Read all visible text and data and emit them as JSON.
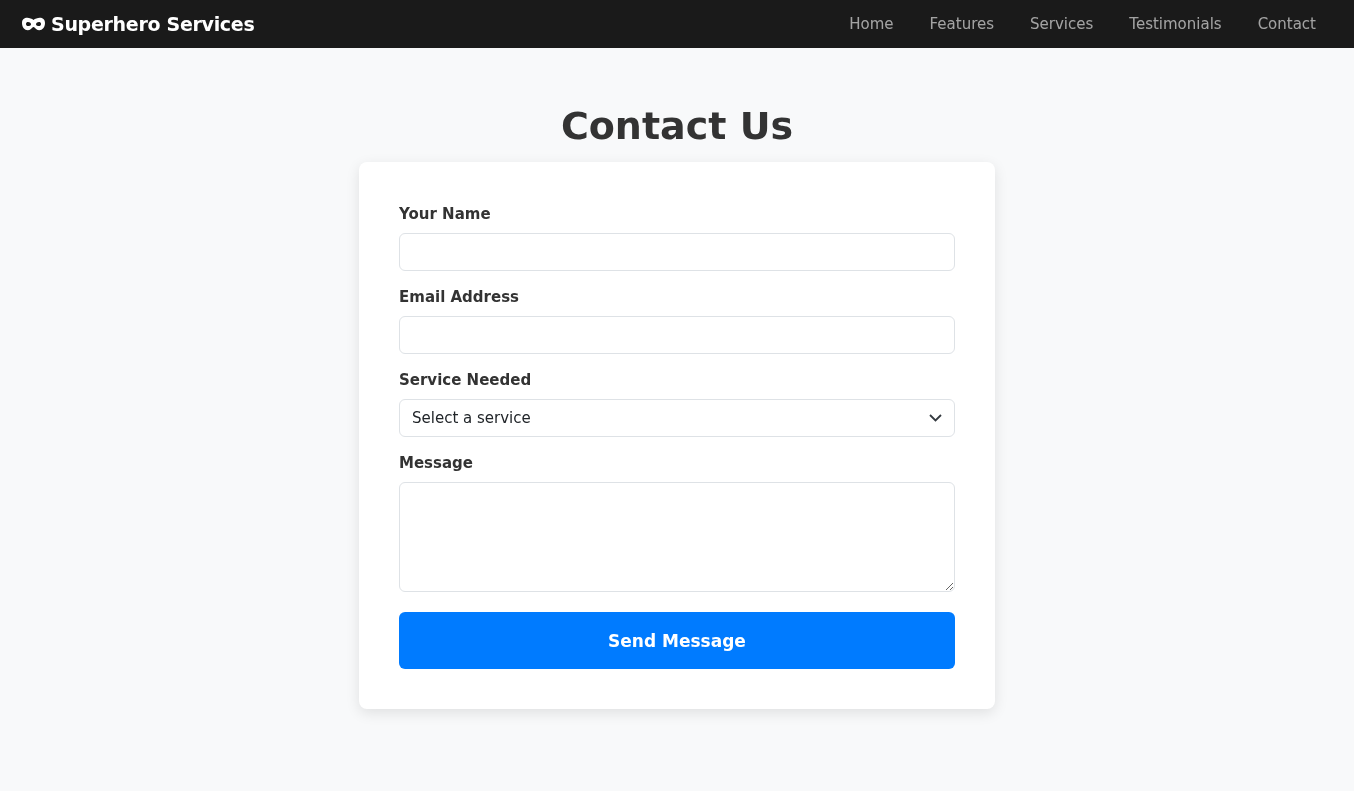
{
  "navbar": {
    "brand": "Superhero Services",
    "links": [
      "Home",
      "Features",
      "Services",
      "Testimonials",
      "Contact"
    ]
  },
  "page": {
    "title": "Contact Us"
  },
  "form": {
    "fields": [
      {
        "kind": "text",
        "label": "Your Name"
      },
      {
        "kind": "email",
        "label": "Email Address"
      },
      {
        "kind": "select",
        "label": "Service Needed",
        "value": "Select a service"
      },
      {
        "kind": "textarea",
        "label": "Message"
      }
    ],
    "submit": "Send Message"
  }
}
